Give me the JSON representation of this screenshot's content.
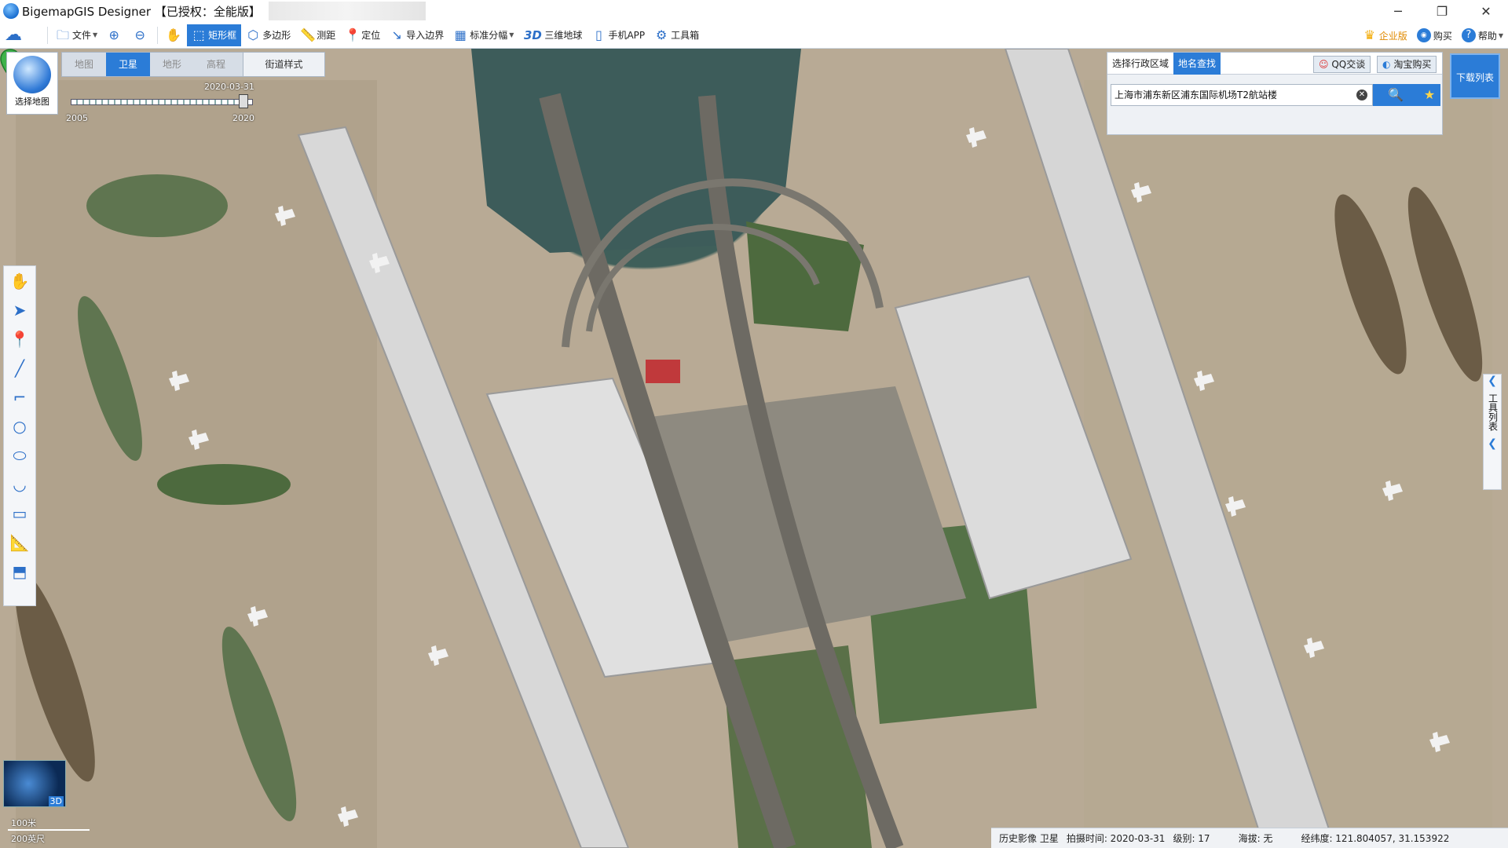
{
  "window": {
    "title": "BigemapGIS Designer 【已授权：全能版】",
    "minimize": "─",
    "restore": "❐",
    "close": "✕"
  },
  "toolbar": {
    "items": [
      {
        "label": "文件",
        "icon": "folder-icon",
        "glyph": "🗀"
      },
      {
        "label": "",
        "icon": "zoom-in-icon",
        "glyph": "⊕"
      },
      {
        "label": "",
        "icon": "zoom-out-icon",
        "glyph": "⊖"
      },
      {
        "label": "",
        "icon": "pan-hand-icon",
        "glyph": "✋"
      },
      {
        "label": "矩形框",
        "icon": "rectangle-select-icon",
        "glyph": "⬚"
      },
      {
        "label": "多边形",
        "icon": "polygon-icon",
        "glyph": "⬡"
      },
      {
        "label": "测距",
        "icon": "ruler-icon",
        "glyph": "📏"
      },
      {
        "label": "定位",
        "icon": "location-pin-icon",
        "glyph": "📍"
      },
      {
        "label": "导入边界",
        "icon": "import-boundary-icon",
        "glyph": "↘"
      },
      {
        "label": "标准分幅",
        "icon": "grid-icon",
        "glyph": "▦"
      },
      {
        "label": "三维地球",
        "icon": "3d-icon",
        "glyph": "3D"
      },
      {
        "label": "手机APP",
        "icon": "phone-icon",
        "glyph": "▯"
      },
      {
        "label": "工具箱",
        "icon": "gear-icon",
        "glyph": "⚙"
      }
    ],
    "right": {
      "enterprise": "企业版",
      "buy": "购买",
      "help": "帮助"
    }
  },
  "map_types": {
    "tabs": [
      "地图",
      "卫星",
      "地形",
      "高程"
    ],
    "active": "卫星",
    "street_style": "街道样式",
    "select_map": "选择地图"
  },
  "timeline": {
    "current_date": "2020-03-31",
    "start_year": "2005",
    "end_year": "2020"
  },
  "search": {
    "tabs": [
      "选择行政区域",
      "地名查找"
    ],
    "active_tab": "地名查找",
    "qq_label": "QQ交谈",
    "taobao_label": "淘宝购买",
    "query": "上海市浦东新区浦东国际机场T2航站楼",
    "download_list": "下载列表"
  },
  "tool_list": {
    "label": "工具列表"
  },
  "minimap": {
    "badge": "3D"
  },
  "scale": {
    "metric": "100米",
    "imperial": "200英尺"
  },
  "status": {
    "source": "历史影像 卫星",
    "capture_time": "拍摄时间: 2020-03-31",
    "level": "级别:  17",
    "elevation": "海拔: 无",
    "coords": "经纬度:   121.804057, 31.153922"
  },
  "colors": {
    "accent": "#2b7cd7",
    "marker": "#3fb24a",
    "ground": "#b8aa95"
  }
}
